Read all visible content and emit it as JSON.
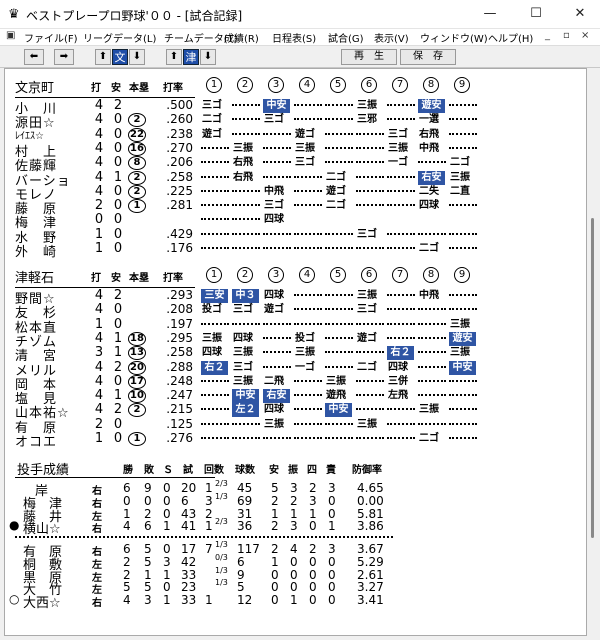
{
  "window": {
    "title": "ベストプレープロ野球'００ - [試合記録]",
    "min_label": "—",
    "max_label": "☐",
    "close_label": "✕"
  },
  "menu": [
    "ファイル(F)",
    "リーグデータ(L)",
    "チームデータ(T)",
    "成績(R)",
    "日程表(S)",
    "試合(G)",
    "表示(V)",
    "ウィンドウ(W)",
    "ヘルプ(H)"
  ],
  "mdi": {
    "min": "_",
    "restore": "▫",
    "close": "×"
  },
  "toolbar": {
    "prev": "⬅",
    "next": "➡",
    "up1": "⬆",
    "team1": "文",
    "down1": "⬇",
    "up2": "⬆",
    "team2": "津",
    "down2": "⬇",
    "play_label": "再　生",
    "save_label": "保　存"
  },
  "headers": {
    "ab": "打",
    "hit": "安",
    "hr": "本塁",
    "avg": "打率"
  },
  "innings": [
    "1",
    "2",
    "3",
    "4",
    "5",
    "6",
    "7",
    "8",
    "9"
  ],
  "team1": {
    "name": "文京町",
    "rows": [
      {
        "name": "小　川",
        "ab": "4",
        "h": "2",
        "hr": "",
        "avg": ".500",
        "cells": [
          "三ゴ",
          "…",
          "中安",
          "…",
          "…",
          "三振",
          "…",
          "遊安",
          "…"
        ]
      },
      {
        "name": "源田☆",
        "ab": "4",
        "h": "0",
        "hr": "2",
        "avg": ".260",
        "cells": [
          "二ゴ",
          "…",
          "三ゴ",
          "…",
          "…",
          "三邪",
          "…",
          "一選",
          "…"
        ]
      },
      {
        "name": "ﾚｲｴｽ☆",
        "ab": "4",
        "h": "0",
        "hr": "22",
        "avg": ".238",
        "cells": [
          "遊ゴ",
          "…",
          "…",
          "遊ゴ",
          "…",
          "…",
          "三ゴ",
          "右飛",
          "…"
        ]
      },
      {
        "name": "村　上",
        "ab": "4",
        "h": "0",
        "hr": "16",
        "avg": ".270",
        "cells": [
          "…",
          "三振",
          "…",
          "三振",
          "…",
          "…",
          "三振",
          "中飛",
          "…"
        ]
      },
      {
        "name": "佐藤輝",
        "ab": "4",
        "h": "0",
        "hr": "8",
        "avg": ".206",
        "cells": [
          "…",
          "右飛",
          "…",
          "三ゴ",
          "…",
          "…",
          "一ゴ",
          "…",
          "二ゴ"
        ]
      },
      {
        "name": "バーショ",
        "ab": "4",
        "h": "1",
        "hr": "2",
        "avg": ".258",
        "cells": [
          "…",
          "右飛",
          "…",
          "…",
          "二ゴ",
          "…",
          "…",
          "右安",
          "三振"
        ]
      },
      {
        "name": "モレノ",
        "ab": "4",
        "h": "0",
        "hr": "2",
        "avg": ".225",
        "cells": [
          "…",
          "…",
          "中飛",
          "…",
          "遊ゴ",
          "…",
          "…",
          "二失",
          "二直"
        ]
      },
      {
        "name": "藤　原",
        "ab": "2",
        "h": "0",
        "hr": "1",
        "avg": ".281",
        "cells": [
          "…",
          "…",
          "三ゴ",
          "…",
          "二ゴ",
          "…",
          "…",
          "四球",
          "…"
        ]
      },
      {
        "name": "梅　津",
        "ab": "0",
        "h": "0",
        "hr": "",
        "avg": "",
        "cells": [
          "…",
          "…",
          "四球",
          "",
          "",
          "",
          "",
          "",
          ""
        ]
      },
      {
        "name": "水　野",
        "ab": "1",
        "h": "0",
        "hr": "",
        "avg": ".429",
        "cells": [
          "…",
          "…",
          "…",
          "…",
          "…",
          "三ゴ",
          "…",
          "…",
          "…"
        ]
      },
      {
        "name": "外　崎",
        "ab": "1",
        "h": "0",
        "hr": "",
        "avg": ".176",
        "cells": [
          "…",
          "…",
          "…",
          "…",
          "…",
          "…",
          "…",
          "二ゴ",
          "…"
        ]
      }
    ]
  },
  "team2": {
    "name": "津軽石",
    "rows": [
      {
        "name": "野間☆",
        "ab": "4",
        "h": "2",
        "hr": "",
        "avg": ".293",
        "cells": [
          "三安",
          "中３",
          "四球",
          "…",
          "…",
          "三振",
          "…",
          "中飛",
          "…"
        ]
      },
      {
        "name": "友　杉",
        "ab": "4",
        "h": "0",
        "hr": "",
        "avg": ".208",
        "cells": [
          "投ゴ",
          "三ゴ",
          "遊ゴ",
          "…",
          "…",
          "三ゴ",
          "…",
          "…",
          "…"
        ]
      },
      {
        "name": "松本直",
        "ab": "1",
        "h": "0",
        "hr": "",
        "avg": ".197",
        "cells": [
          "…",
          "…",
          "…",
          "…",
          "…",
          "…",
          "…",
          "…",
          "三振"
        ]
      },
      {
        "name": "チゾム",
        "ab": "4",
        "h": "1",
        "hr": "18",
        "avg": ".295",
        "cells": [
          "三振",
          "四球",
          "…",
          "投ゴ",
          "…",
          "遊ゴ",
          "…",
          "…",
          "遊安"
        ]
      },
      {
        "name": "清　宮",
        "ab": "3",
        "h": "1",
        "hr": "13",
        "avg": ".258",
        "cells": [
          "四球",
          "三振",
          "…",
          "三振",
          "…",
          "…",
          "右２",
          "…",
          "三振"
        ]
      },
      {
        "name": "メリル",
        "ab": "4",
        "h": "2",
        "hr": "20",
        "avg": ".288",
        "cells": [
          "右２",
          "三ゴ",
          "…",
          "一ゴ",
          "…",
          "二ゴ",
          "四球",
          "…",
          "中安"
        ]
      },
      {
        "name": "岡　本",
        "ab": "4",
        "h": "0",
        "hr": "17",
        "avg": ".248",
        "cells": [
          "…",
          "三振",
          "二飛",
          "…",
          "三振",
          "…",
          "三併",
          "…",
          "…"
        ]
      },
      {
        "name": "塩　見",
        "ab": "4",
        "h": "1",
        "hr": "10",
        "avg": ".247",
        "cells": [
          "…",
          "中安",
          "右安",
          "…",
          "遊飛",
          "…",
          "左飛",
          "…",
          "…"
        ]
      },
      {
        "name": "山本祐☆",
        "ab": "4",
        "h": "2",
        "hr": "2",
        "avg": ".215",
        "cells": [
          "…",
          "左２",
          "四球",
          "…",
          "中安",
          "…",
          "…",
          "三振",
          "…"
        ]
      },
      {
        "name": "有　原",
        "ab": "2",
        "h": "0",
        "hr": "",
        "avg": ".125",
        "cells": [
          "…",
          "…",
          "三振",
          "…",
          "…",
          "三振",
          "…",
          "…",
          "…"
        ]
      },
      {
        "name": "オコエ",
        "ab": "1",
        "h": "0",
        "hr": "1",
        "avg": ".276",
        "cells": [
          "…",
          "…",
          "…",
          "…",
          "…",
          "…",
          "…",
          "二ゴ",
          "…"
        ]
      }
    ]
  },
  "pitch_headers": {
    "title": "投手成績",
    "w": "勝",
    "l": "敗",
    "s": "Ｓ",
    "g": "試",
    "ip": "回数",
    "bf": "球数",
    "h": "安",
    "k": "振",
    "bb": "四",
    "er": "責",
    "era": "防御率"
  },
  "pitchers_top": [
    {
      "mark": "",
      "name": "岸",
      "hand": "右",
      "w": "6",
      "l": "9",
      "s": "0",
      "g": "20",
      "ip": "1",
      "ipf": "2/3",
      "bf": "45",
      "h": "5",
      "k": "3",
      "bb": "2",
      "er": "3",
      "era": "4.65"
    },
    {
      "mark": "",
      "name": "梅　津",
      "hand": "右",
      "w": "0",
      "l": "0",
      "s": "0",
      "g": "6",
      "ip": "3",
      "ipf": "1/3",
      "bf": "69",
      "h": "2",
      "k": "2",
      "bb": "3",
      "er": "0",
      "era": "0.00"
    },
    {
      "mark": "",
      "name": "藤　井",
      "hand": "左",
      "w": "1",
      "l": "2",
      "s": "0",
      "g": "43",
      "ip": "2",
      "ipf": "",
      "bf": "31",
      "h": "1",
      "k": "1",
      "bb": "1",
      "er": "0",
      "era": "5.81"
    },
    {
      "mark": "●",
      "name": "横山☆",
      "hand": "右",
      "w": "4",
      "l": "6",
      "s": "1",
      "g": "41",
      "ip": "1",
      "ipf": "2/3",
      "bf": "36",
      "h": "2",
      "k": "3",
      "bb": "0",
      "er": "1",
      "era": "3.86"
    }
  ],
  "pitchers_bottom": [
    {
      "mark": "",
      "name": "有　原",
      "hand": "右",
      "w": "6",
      "l": "5",
      "s": "0",
      "g": "17",
      "ip": "7",
      "ipf": "1/3",
      "bf": "117",
      "h": "2",
      "k": "4",
      "bb": "2",
      "er": "3",
      "era": "3.67"
    },
    {
      "mark": "",
      "name": "桐　敷",
      "hand": "左",
      "w": "2",
      "l": "5",
      "s": "3",
      "g": "42",
      "ip": "",
      "ipf": "0/3",
      "bf": "6",
      "h": "1",
      "k": "0",
      "bb": "0",
      "er": "0",
      "era": "5.29"
    },
    {
      "mark": "",
      "name": "黒　原",
      "hand": "左",
      "w": "2",
      "l": "1",
      "s": "1",
      "g": "33",
      "ip": "",
      "ipf": "1/3",
      "bf": "9",
      "h": "0",
      "k": "0",
      "bb": "0",
      "er": "0",
      "era": "2.61"
    },
    {
      "mark": "",
      "name": "大　竹",
      "hand": "左",
      "w": "5",
      "l": "5",
      "s": "0",
      "g": "23",
      "ip": "",
      "ipf": "1/3",
      "bf": "5",
      "h": "0",
      "k": "0",
      "bb": "0",
      "er": "0",
      "era": "3.27"
    },
    {
      "mark": "○",
      "name": "大西☆",
      "hand": "右",
      "w": "4",
      "l": "3",
      "s": "1",
      "g": "33",
      "ip": "1",
      "ipf": "",
      "bf": "12",
      "h": "0",
      "k": "1",
      "bb": "0",
      "er": "0",
      "era": "3.41"
    }
  ],
  "highlight_color": "#2f55a4"
}
